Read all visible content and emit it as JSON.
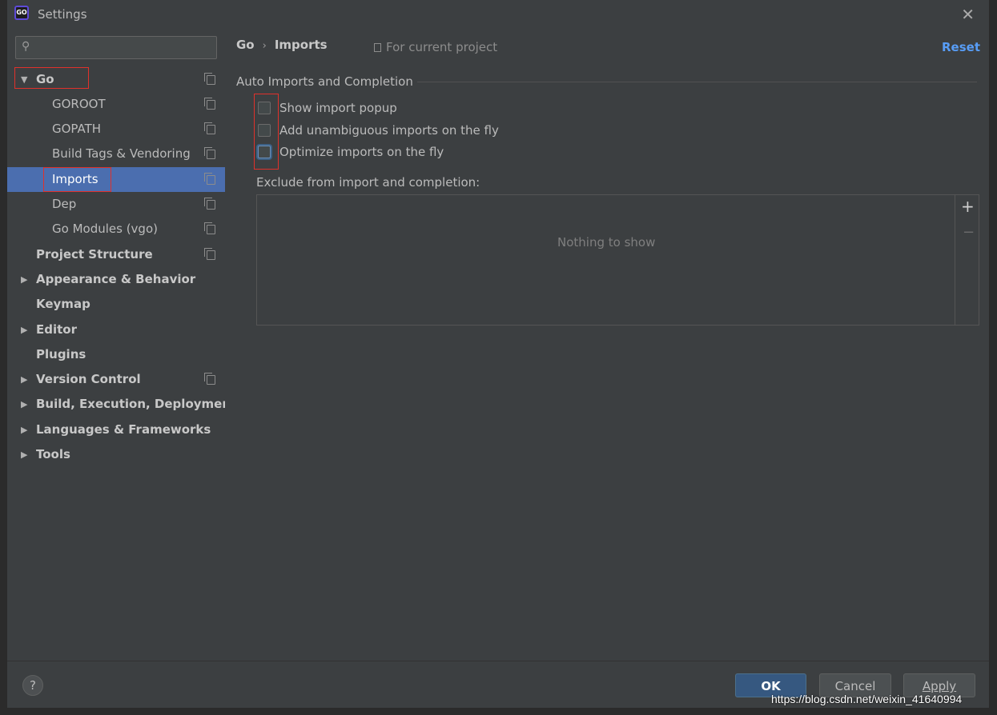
{
  "window": {
    "title": "Settings",
    "app_icon": "GO",
    "close_glyph": "✕"
  },
  "sidebar": {
    "search": {
      "placeholder": ""
    },
    "items": [
      {
        "label": "Go",
        "expanded": true
      },
      {
        "label": "GOROOT"
      },
      {
        "label": "GOPATH"
      },
      {
        "label": "Build Tags & Vendoring"
      },
      {
        "label": "Imports",
        "selected": true
      },
      {
        "label": "Dep"
      },
      {
        "label": "Go Modules (vgo)"
      },
      {
        "label": "Project Structure"
      },
      {
        "label": "Appearance & Behavior"
      },
      {
        "label": "Keymap"
      },
      {
        "label": "Editor"
      },
      {
        "label": "Plugins"
      },
      {
        "label": "Version Control"
      },
      {
        "label": "Build, Execution, Deployment"
      },
      {
        "label": "Languages & Frameworks"
      },
      {
        "label": "Tools"
      }
    ]
  },
  "content": {
    "breadcrumb": [
      "Go",
      "Imports"
    ],
    "scope": "For current project",
    "reset": "Reset",
    "section_title": "Auto Imports and Completion",
    "checkboxes": [
      {
        "label": "Show import popup",
        "checked": false
      },
      {
        "label": "Add unambiguous imports on the fly",
        "checked": false
      },
      {
        "label": "Optimize imports on the fly",
        "checked": false
      }
    ],
    "exclude_label": "Exclude from import and completion:",
    "empty_text": "Nothing to show",
    "add_glyph": "+",
    "remove_glyph": "−"
  },
  "footer": {
    "help": "?",
    "ok": "OK",
    "cancel": "Cancel",
    "apply": "Apply"
  },
  "watermark": "https://blog.csdn.net/weixin_41640994",
  "colors": {
    "accent": "#4b6eaf",
    "link": "#589df6",
    "highlight": "#e0312b"
  }
}
